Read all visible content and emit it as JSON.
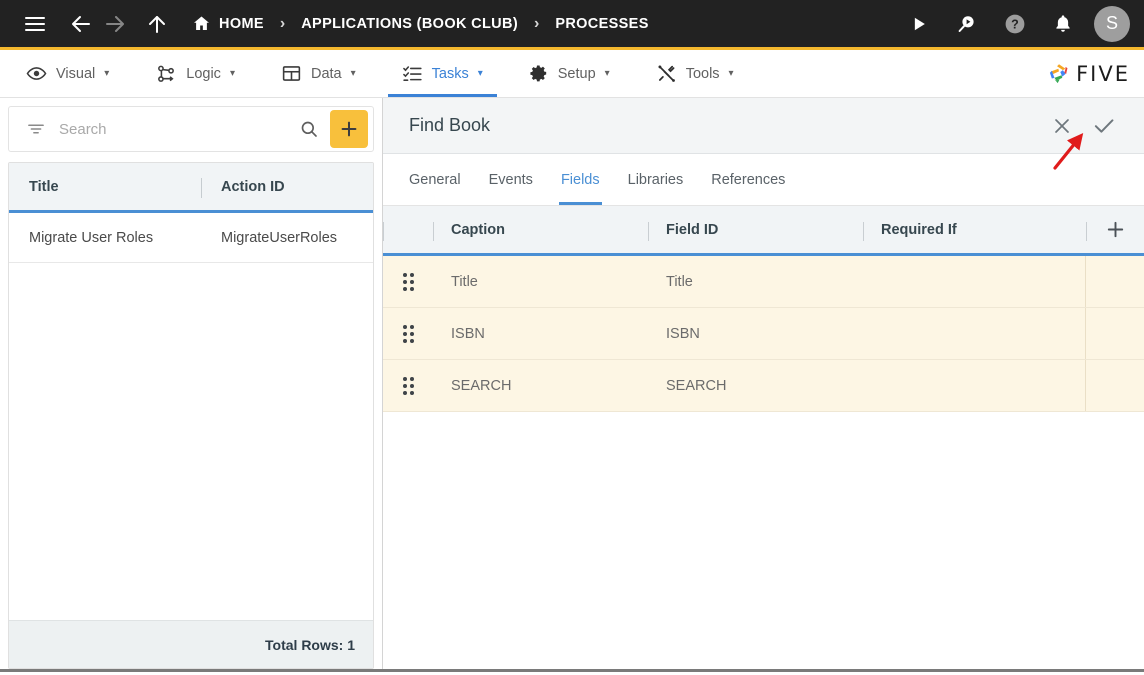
{
  "topbar": {
    "menu_label": "Menu",
    "back_label": "Back",
    "forward_label": "Forward",
    "up_label": "Up",
    "breadcrumbs": [
      {
        "label": "HOME",
        "icon": "home-icon"
      },
      {
        "label": "APPLICATIONS (BOOK CLUB)",
        "icon": ""
      },
      {
        "label": "PROCESSES",
        "icon": ""
      }
    ],
    "separator": "›",
    "actions": [
      {
        "name": "run-icon",
        "label": "Run"
      },
      {
        "name": "search-play-icon",
        "label": "Search"
      },
      {
        "name": "help-icon",
        "label": "Help"
      },
      {
        "name": "notifications-icon",
        "label": "Notifications"
      }
    ],
    "avatar_initial": "S",
    "background": "#222222",
    "accent_underline": "#F5B82E"
  },
  "menubar": {
    "items": [
      {
        "label": "Visual",
        "icon": "eye-icon",
        "caret": "▾",
        "active": false
      },
      {
        "label": "Logic",
        "icon": "nodes-icon",
        "caret": "▾",
        "active": false
      },
      {
        "label": "Data",
        "icon": "table-icon",
        "caret": "▾",
        "active": false
      },
      {
        "label": "Tasks",
        "icon": "tasklist-icon",
        "caret": "▾",
        "active": true
      },
      {
        "label": "Setup",
        "icon": "gear-icon",
        "caret": "▾",
        "active": false
      },
      {
        "label": "Tools",
        "icon": "tools-icon",
        "caret": "▾",
        "active": false
      }
    ],
    "logo_text": "FIVE",
    "active_color": "#3b82d6"
  },
  "left_panel": {
    "search": {
      "placeholder": "Search",
      "value": ""
    },
    "filter_icon": "filter-icon",
    "search_icon": "search-icon",
    "add_button": {
      "label": "+",
      "color": "#F8C03C"
    },
    "columns": [
      "Title",
      "Action ID"
    ],
    "rows": [
      {
        "title": "Migrate User Roles",
        "action_id": "MigrateUserRoles"
      }
    ],
    "footer_label": "Total Rows: 1"
  },
  "right_panel": {
    "title": "Find Book",
    "close_label": "Close",
    "confirm_label": "Save",
    "tabs": [
      {
        "label": "General",
        "active": false
      },
      {
        "label": "Events",
        "active": false
      },
      {
        "label": "Fields",
        "active": true
      },
      {
        "label": "Libraries",
        "active": false
      },
      {
        "label": "References",
        "active": false
      }
    ],
    "fields_table": {
      "columns": [
        "Caption",
        "Field ID",
        "Required If"
      ],
      "add_column_label": "+",
      "rows": [
        {
          "caption": "Title",
          "field_id": "Title",
          "required_if": ""
        },
        {
          "caption": "ISBN",
          "field_id": "ISBN",
          "required_if": ""
        },
        {
          "caption": "SEARCH",
          "field_id": "SEARCH",
          "required_if": ""
        }
      ],
      "row_background": "#FDF6E4",
      "header_underline": "#4a8fd4"
    }
  },
  "annotation": {
    "type": "arrow",
    "color": "#E01B1B",
    "points_to": "confirm-check-button"
  }
}
